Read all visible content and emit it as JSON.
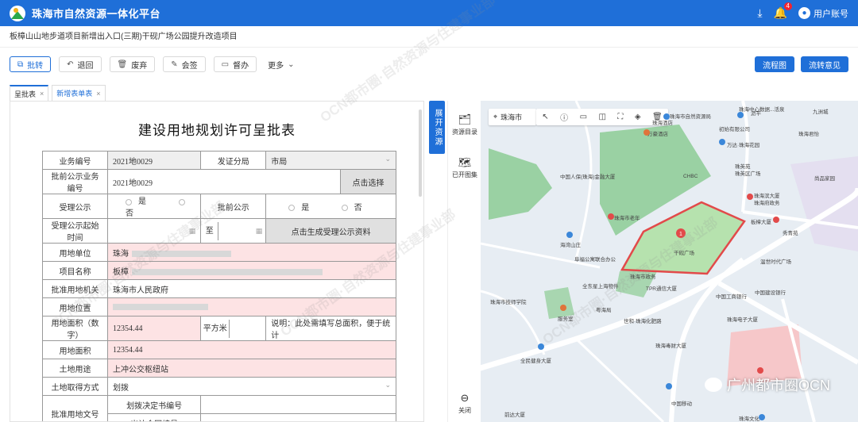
{
  "app": {
    "title": "珠海市自然资源一体化平台",
    "notification_count": "4",
    "user_label": "用户账号"
  },
  "project": {
    "title": "板樟山山地步道项目新增出入口(三期)干砚广场公园提升改造项目"
  },
  "toolbar": {
    "approve": "批转",
    "return": "退回",
    "discard": "废弃",
    "countersign": "会签",
    "supervise": "督办",
    "more": "更多",
    "flowchart": "流程图",
    "transfer_opinion": "流转意见"
  },
  "tabs": [
    {
      "label": "呈批表"
    },
    {
      "label": "新增表单表"
    }
  ],
  "form": {
    "title": "建设用地规划许可呈批表",
    "rows": {
      "business_no_label": "业务编号",
      "business_no": "2021地0029",
      "branch_label": "发证分局",
      "branch": "市局",
      "pre_publish_no_label": "批前公示业务编号",
      "pre_publish_no": "2021地0029",
      "select_btn": "点击选择",
      "accept_publish_label": "受理公示",
      "yes": "是",
      "no": "否",
      "pre_publish_label": "批前公示",
      "accept_time_label": "受理公示起始时间",
      "to": "至",
      "gen_btn": "点击生成受理公示资料",
      "unit_label": "用地单位",
      "unit_value": "珠海",
      "project_name_label": "项目名称",
      "project_name_value": "板樟",
      "authority_label": "批准用地机关",
      "authority_value": "珠海市人民政府",
      "location_label": "用地位置",
      "area_num_label": "用地面积（数字）",
      "area_num": "12354.44",
      "unit_sqm": "平方米",
      "area_note": "说明：此处需填写总面积，便于统计",
      "area_label": "用地面积",
      "area": "12354.44",
      "use_label": "土地用途",
      "use_value": "上冲公交枢纽站",
      "acquire_label": "土地取得方式",
      "acquire_value": "划拨",
      "doc_label": "批准用地文号",
      "doc_sub1": "划拨决定书编号",
      "doc_sub2": "出让合同编号"
    }
  },
  "expander": {
    "label": "展开资源"
  },
  "map_side": {
    "resources": "资源目录",
    "opened": "已开图集",
    "close": "关闭"
  },
  "map": {
    "city": "珠海市",
    "marker_number": "1",
    "places": [
      "珠海市自然资源局",
      "沥平",
      "九洲城",
      "珠海中心数据...活泉",
      "珠海酒店",
      "初始有限公司",
      "珠海君怡",
      "万豪酒店",
      "万达·珠海花园",
      "CHBC",
      "珠英苑",
      "珠英区广场",
      "中国人保(珠海)金融大厦",
      "珠海市老年",
      "尚品家园",
      "珠海滨大厦",
      "珠海府政务",
      "板樟大厦",
      "海湾山庄",
      "秀青苑",
      "阜福公寓联合办公",
      "干砚广场",
      "温世时代广场",
      "全东星上海物件",
      "珠海市政务",
      "TPR通信大厦",
      "中国建设银行",
      "中国工商银行",
      "珠海市技师学院",
      "粤海局",
      "世和·珠海化肥路",
      "珠海电子大厦",
      "服务室",
      "珠海毒财大厦",
      "全民健身大厦",
      "前达大厦",
      "中国移动",
      "珠海文化"
    ]
  },
  "watermarks": {
    "org": "OCN都市圈·自然资源与住建事业部",
    "brand": "广州都市圈OCN"
  }
}
